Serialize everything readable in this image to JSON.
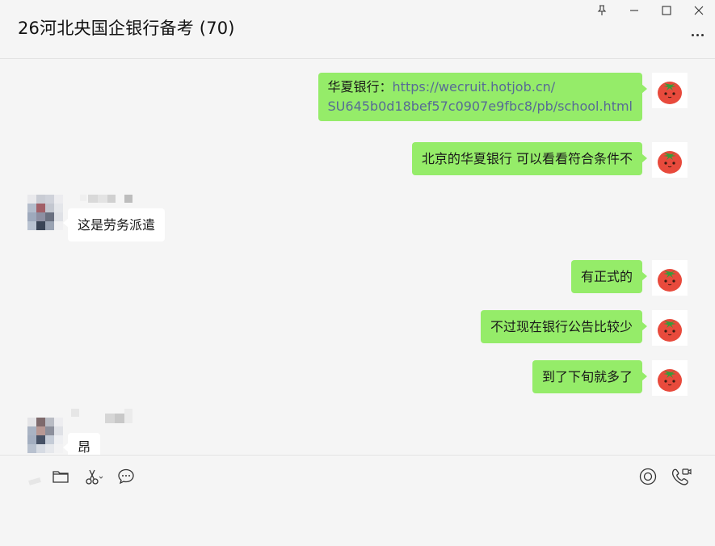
{
  "window": {
    "pin_icon": "pin-icon",
    "minimize_icon": "minimize-icon",
    "maximize_icon": "maximize-icon",
    "close_icon": "close-icon"
  },
  "chat": {
    "title": "26河北央国企银行备考 (70)",
    "more_icon": "more-dots-icon"
  },
  "messages": [
    {
      "side": "right",
      "text_prefix": "华夏银行：",
      "link_line1": "https://wecruit.hotjob.cn/",
      "link_line2": "SU645b0d18bef57c0907e9fbc8/pb/school.html"
    },
    {
      "side": "right",
      "text": "北京的华夏银行 可以看看符合条件不"
    },
    {
      "side": "left",
      "text": "这是劳务派遣"
    },
    {
      "side": "right",
      "text": "有正式的"
    },
    {
      "side": "right",
      "text": "不过现在银行公告比较少"
    },
    {
      "side": "right",
      "text": "到了下旬就多了"
    },
    {
      "side": "left",
      "text": "昂"
    }
  ],
  "toolbar": {
    "left_icons": [
      "emoji-icon",
      "folder-icon",
      "scissors-icon",
      "chat-bubble-icon"
    ],
    "right_icons": [
      "live-icon",
      "video-call-icon"
    ]
  },
  "colors": {
    "my_bubble": "#95ec69",
    "their_bubble": "#ffffff",
    "background": "#f5f5f5",
    "link": "#576b95"
  }
}
